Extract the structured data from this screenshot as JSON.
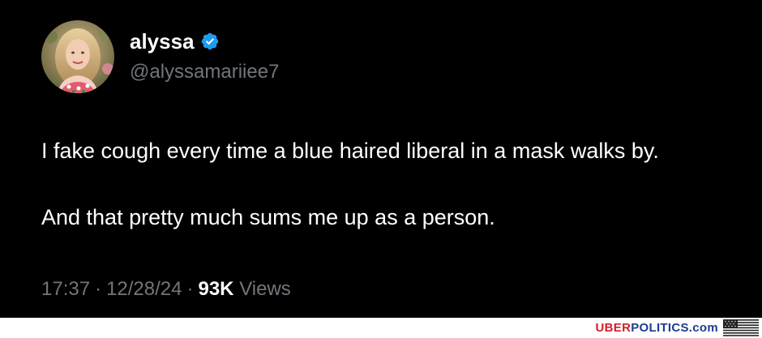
{
  "tweet": {
    "display_name": "alyssa",
    "handle": "@alyssamariiee7",
    "verified": true,
    "verified_color": "#1d9bf0",
    "avatar_icon": "profile-photo",
    "text_lines": [
      "I fake cough every time a blue haired liberal in a mask walks by.",
      "And that pretty much sums me up as a person."
    ],
    "time": "17:37",
    "date": "12/28/24",
    "separator": "·",
    "views_count": "93K",
    "views_label": "Views"
  },
  "footer": {
    "brand_part1": "UBER",
    "brand_part2": "POLITICS",
    "brand_part3": ".com",
    "brand_colors": {
      "uber": "#d11f2a",
      "politics": "#1c3e8f"
    },
    "flag_icon": "us-flag-icon"
  },
  "colors": {
    "background": "#000000",
    "text_primary": "#ffffff",
    "text_secondary": "#71767b"
  }
}
